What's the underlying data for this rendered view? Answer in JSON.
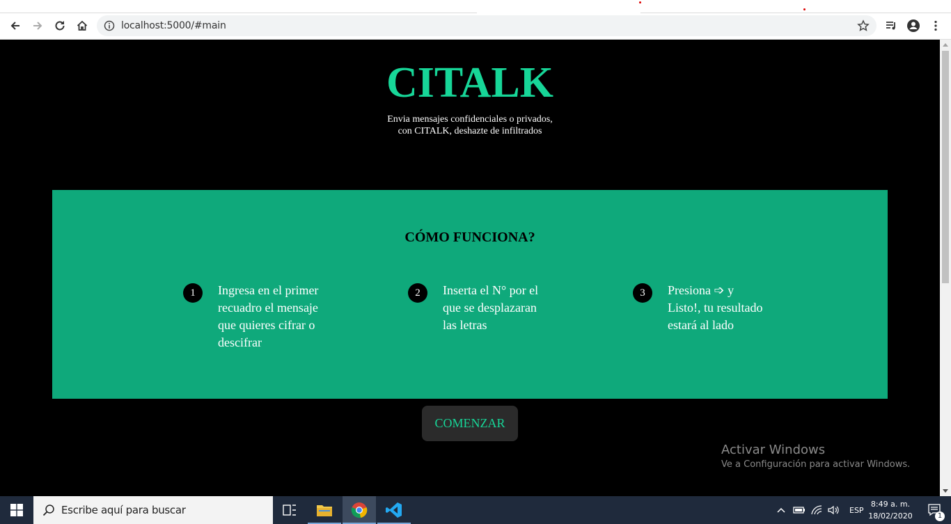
{
  "browser": {
    "url": "localhost:5000/#main"
  },
  "hero": {
    "title": "CITALK",
    "subtitle_line1": "Envia mensajes confidenciales o privados,",
    "subtitle_line2": "con CITALK, deshazte de infiltrados"
  },
  "how_it_works": {
    "title": "CÓMO FUNCIONA?",
    "steps": [
      {
        "number": "1",
        "lines": [
          "Ingresa en el primer",
          "recuadro el mensaje",
          "que quieres cifrar o",
          "descifrar"
        ]
      },
      {
        "number": "2",
        "lines": [
          "Inserta el N° por el",
          "que se desplazaran",
          "las letras"
        ]
      },
      {
        "number": "3",
        "lines": [
          "Presiona ➩ y",
          "Listo!, tu resultado",
          "estará al lado"
        ]
      }
    ]
  },
  "start_button": {
    "label": "COMENZAR"
  },
  "watermark": {
    "line1": "Activar Windows",
    "line2": "Ve a Configuración para activar Windows."
  },
  "taskbar": {
    "search_placeholder": "Escribe aquí para buscar",
    "language": "ESP",
    "time": "8:49 a. m.",
    "date": "18/02/2020",
    "notification_count": "1"
  },
  "colors": {
    "accent": "#17d698",
    "panel": "#0fa97b",
    "background": "#000000",
    "button_bg": "#2b2b2b"
  }
}
